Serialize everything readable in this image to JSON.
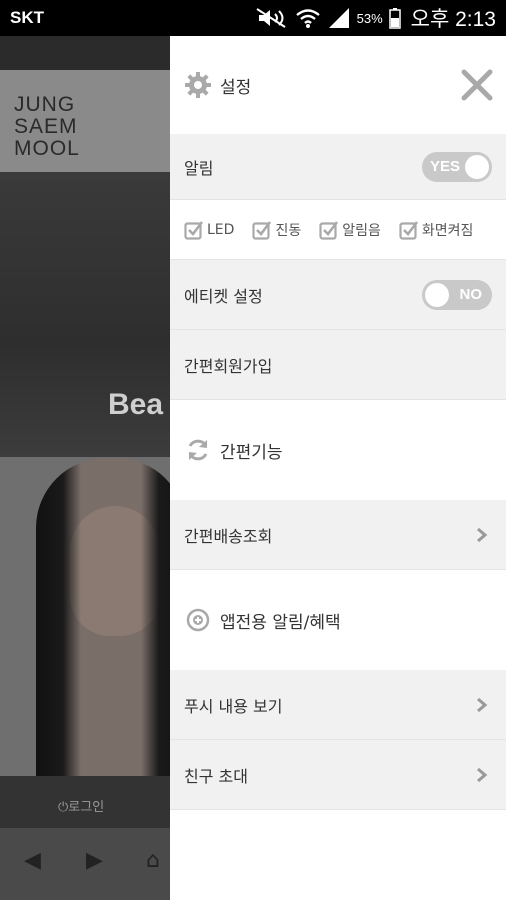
{
  "status_bar": {
    "carrier": "SKT",
    "battery": "53%",
    "time": "오후 2:13"
  },
  "background_app": {
    "logo_lines": [
      "JUNG",
      "SAEM",
      "MOOL"
    ],
    "banner_text": "Bea",
    "login_label": "로그인"
  },
  "drawer": {
    "settings_title": "설정",
    "notification": {
      "label": "알림",
      "toggle": "YES",
      "on": true
    },
    "options": [
      {
        "label": "LED",
        "checked": true
      },
      {
        "label": "진동",
        "checked": true
      },
      {
        "label": "알림음",
        "checked": true
      },
      {
        "label": "화면켜짐",
        "checked": true
      }
    ],
    "etiquette": {
      "label": "에티켓 설정",
      "toggle": "NO",
      "on": false
    },
    "simple_signup": "간편회원가입",
    "quick_title": "간편기능",
    "delivery_lookup": "간편배송조회",
    "app_title": "앱전용 알림/혜택",
    "push_view": "푸시 내용 보기",
    "invite": "친구 초대"
  },
  "colors": {
    "accent_gray": "#a9a9a9",
    "toggle_bg": "#c9c9c9",
    "row_gray": "#f1f1f1"
  }
}
